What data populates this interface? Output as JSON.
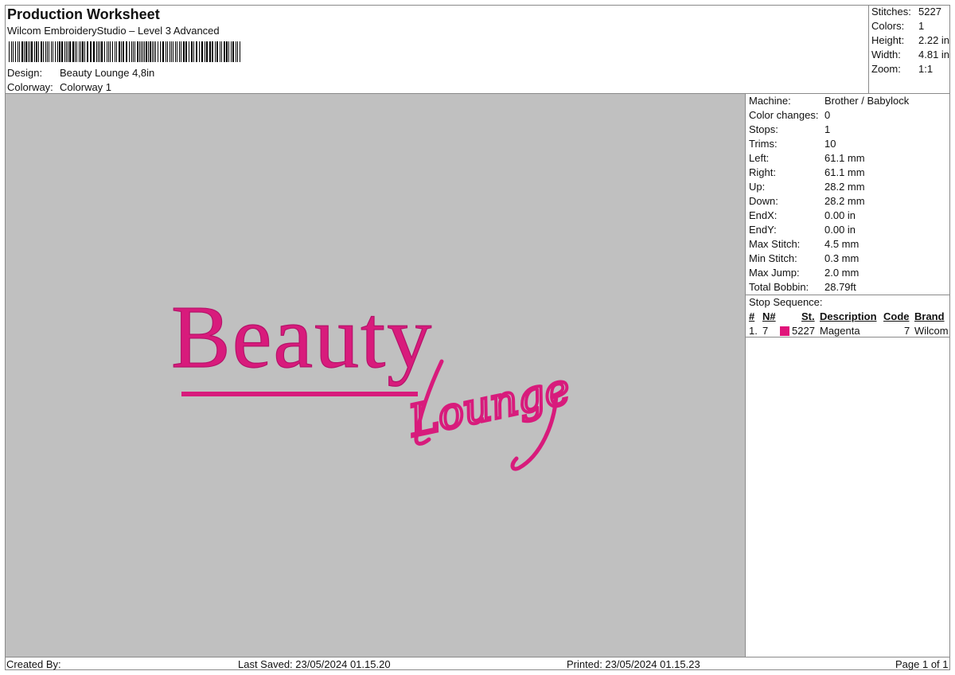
{
  "header": {
    "title": "Production Worksheet",
    "subtitle": "Wilcom EmbroideryStudio – Level 3 Advanced",
    "design_label": "Design:",
    "design_value": "Beauty Lounge 4,8in",
    "colorway_label": "Colorway:",
    "colorway_value": "Colorway 1"
  },
  "summary": [
    {
      "label": "Stitches:",
      "value": "5227"
    },
    {
      "label": "Colors:",
      "value": "1"
    },
    {
      "label": "Height:",
      "value": "2.22 in"
    },
    {
      "label": "Width:",
      "value": "4.81 in"
    },
    {
      "label": "Zoom:",
      "value": "1:1"
    }
  ],
  "details": [
    {
      "label": "Machine:",
      "value": "Brother / Babylock"
    },
    {
      "label": "Color changes:",
      "value": "0"
    },
    {
      "label": "Stops:",
      "value": "1"
    },
    {
      "label": "Trims:",
      "value": "10"
    },
    {
      "label": "Left:",
      "value": "61.1 mm"
    },
    {
      "label": "Right:",
      "value": "61.1 mm"
    },
    {
      "label": "Up:",
      "value": "28.2 mm"
    },
    {
      "label": "Down:",
      "value": "28.2 mm"
    },
    {
      "label": "EndX:",
      "value": "0.00 in"
    },
    {
      "label": "EndY:",
      "value": "0.00 in"
    },
    {
      "label": "Max Stitch:",
      "value": "4.5 mm"
    },
    {
      "label": "Min Stitch:",
      "value": "0.3 mm"
    },
    {
      "label": "Max Jump:",
      "value": "2.0 mm"
    },
    {
      "label": "Total Bobbin:",
      "value": "28.79ft"
    }
  ],
  "stop_sequence": {
    "title": "Stop Sequence:",
    "columns": [
      "#",
      "N#",
      "St.",
      "Description",
      "Code",
      "Brand"
    ],
    "rows": [
      {
        "num": "1.",
        "n": "7",
        "st": "5227",
        "description": "Magenta",
        "code": "7",
        "brand": "Wilcom",
        "color": "#e0147a"
      }
    ]
  },
  "design_preview": {
    "main_text": "Beauty",
    "script_text": "Lounge",
    "thread_color": "#d81b7c",
    "background": "#c0c0c0"
  },
  "footer": {
    "created_by": "Created By:",
    "last_saved": "Last Saved: 23/05/2024 01.15.20",
    "printed": "Printed: 23/05/2024 01.15.23",
    "page": "Page 1 of 1"
  }
}
